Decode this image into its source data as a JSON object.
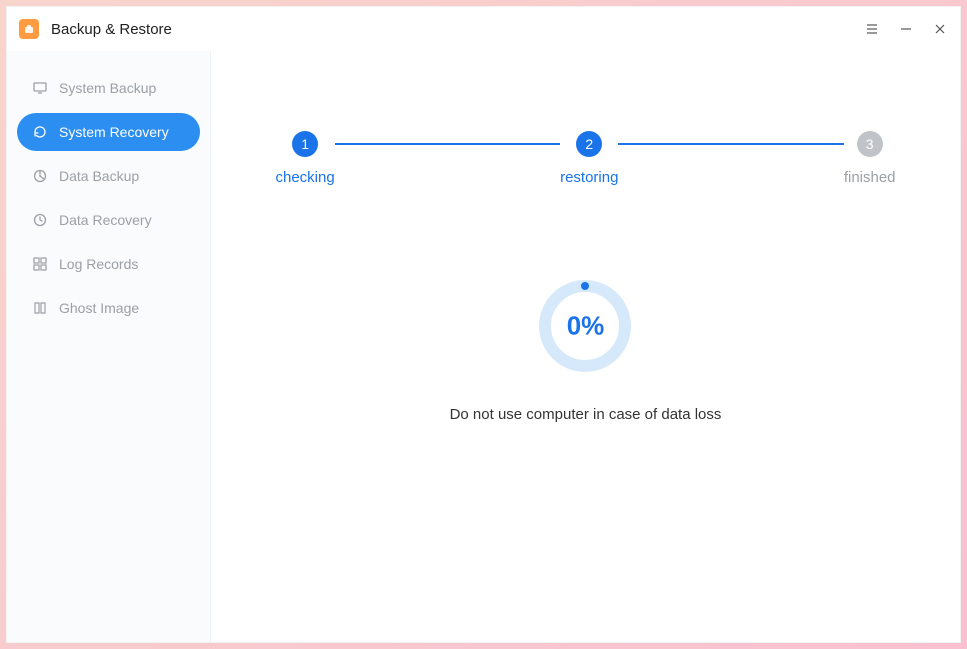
{
  "titlebar": {
    "title": "Backup & Restore"
  },
  "sidebar": {
    "items": [
      {
        "icon": "monitor-icon",
        "label": "System Backup",
        "active": false
      },
      {
        "icon": "refresh-icon",
        "label": "System Recovery",
        "active": true
      },
      {
        "icon": "piechart-icon",
        "label": "Data Backup",
        "active": false
      },
      {
        "icon": "clock-icon",
        "label": "Data Recovery",
        "active": false
      },
      {
        "icon": "grid-icon",
        "label": "Log Records",
        "active": false
      },
      {
        "icon": "book-icon",
        "label": "Ghost Image",
        "active": false
      }
    ]
  },
  "steps": [
    {
      "num": "1",
      "label": "checking",
      "state": "active"
    },
    {
      "num": "2",
      "label": "restoring",
      "state": "active"
    },
    {
      "num": "3",
      "label": "finished",
      "state": "inactive"
    }
  ],
  "progress": {
    "value_text": "0%"
  },
  "main": {
    "warning": "Do not use computer in case of data loss"
  }
}
